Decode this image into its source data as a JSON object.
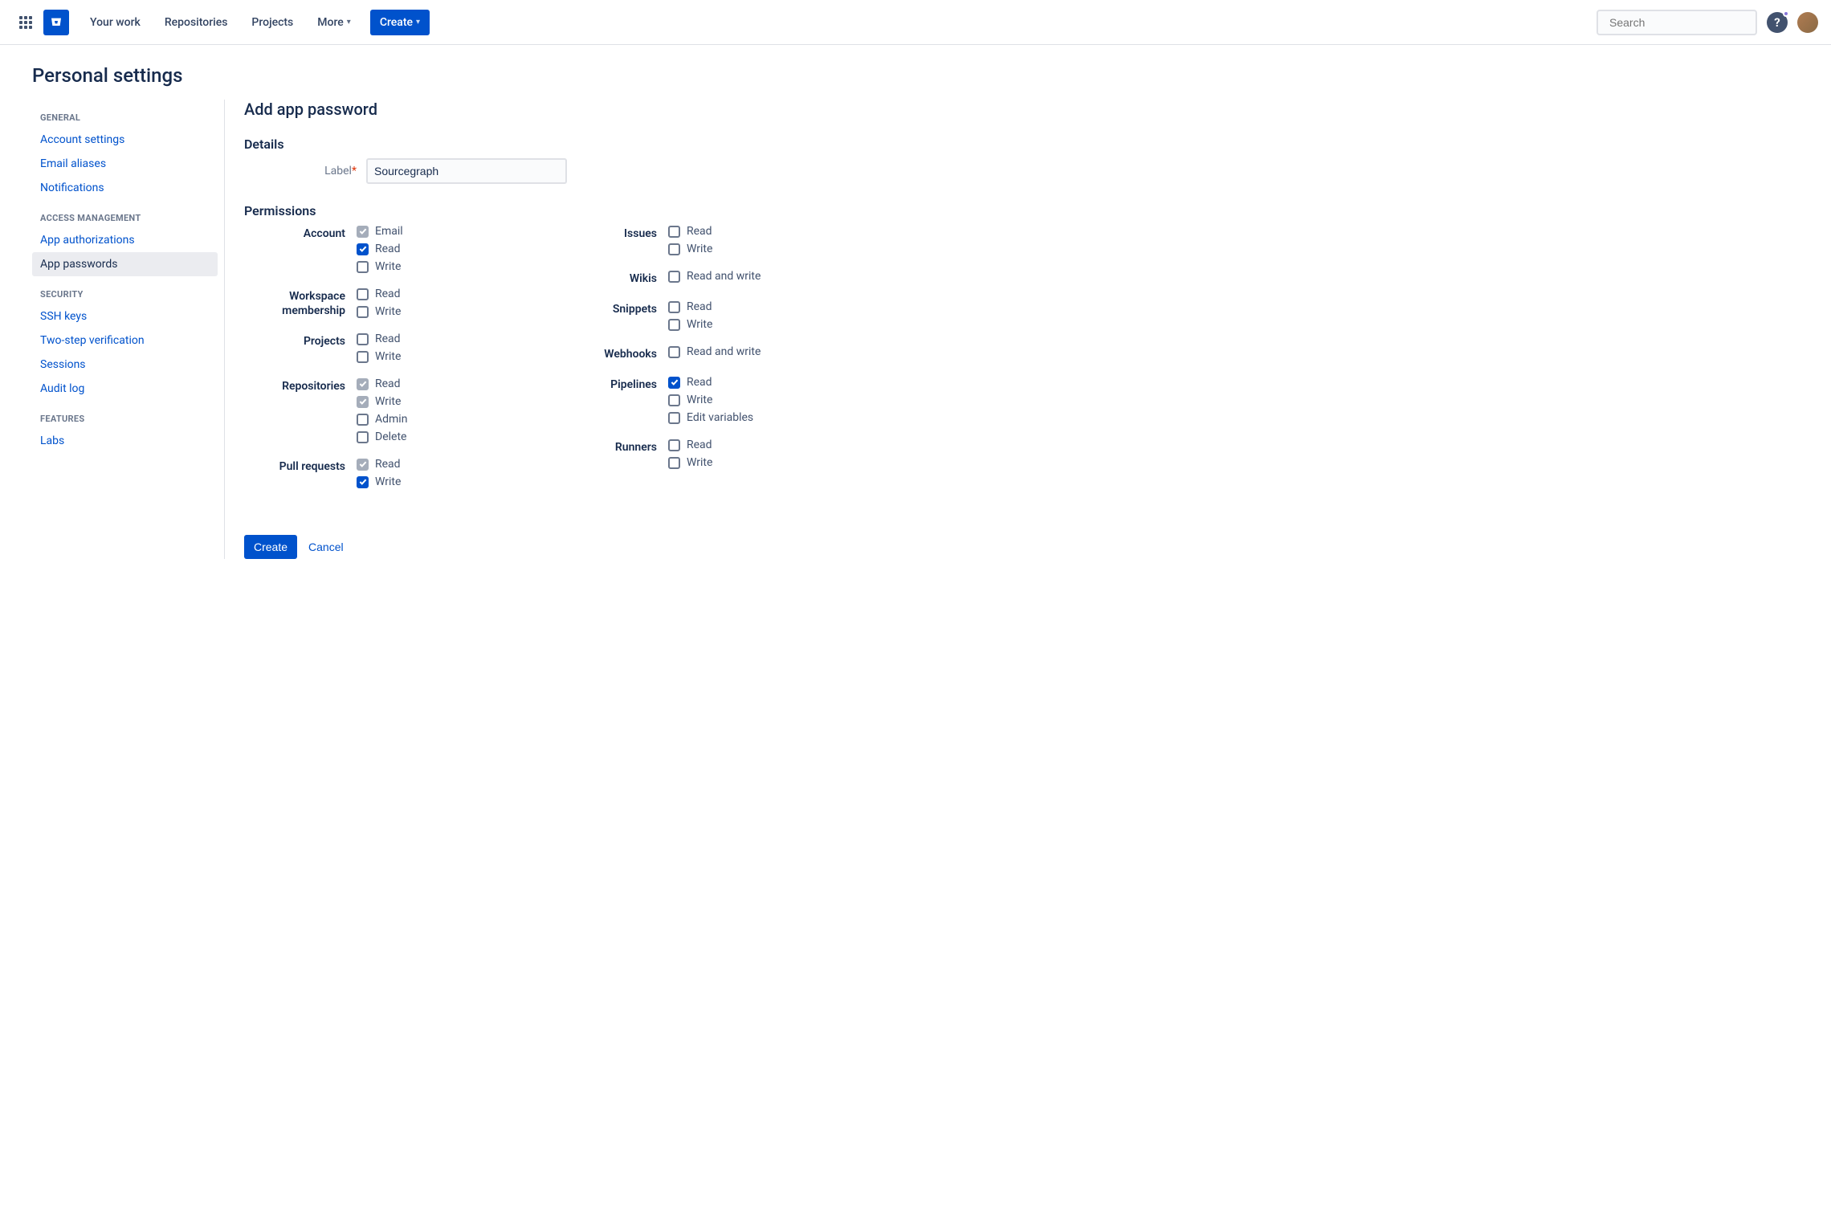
{
  "topnav": {
    "items": [
      {
        "label": "Your work"
      },
      {
        "label": "Repositories"
      },
      {
        "label": "Projects"
      },
      {
        "label": "More"
      }
    ],
    "create_label": "Create",
    "search_placeholder": "Search"
  },
  "page_title": "Personal settings",
  "sidebar": {
    "sections": [
      {
        "label": "GENERAL",
        "items": [
          {
            "label": "Account settings"
          },
          {
            "label": "Email aliases"
          },
          {
            "label": "Notifications"
          }
        ]
      },
      {
        "label": "ACCESS MANAGEMENT",
        "items": [
          {
            "label": "App authorizations"
          },
          {
            "label": "App passwords",
            "active": true
          }
        ]
      },
      {
        "label": "SECURITY",
        "items": [
          {
            "label": "SSH keys"
          },
          {
            "label": "Two-step verification"
          },
          {
            "label": "Sessions"
          },
          {
            "label": "Audit log"
          }
        ]
      },
      {
        "label": "FEATURES",
        "items": [
          {
            "label": "Labs"
          }
        ]
      }
    ]
  },
  "main": {
    "heading": "Add app password",
    "details_heading": "Details",
    "label_field": {
      "label": "Label",
      "value": "Sourcegraph"
    },
    "permissions_heading": "Permissions",
    "left_groups": [
      {
        "name": "Account",
        "opts": [
          {
            "label": "Email",
            "state": "disabled"
          },
          {
            "label": "Read",
            "state": "checked"
          },
          {
            "label": "Write",
            "state": ""
          }
        ]
      },
      {
        "name": "Workspace membership",
        "opts": [
          {
            "label": "Read",
            "state": ""
          },
          {
            "label": "Write",
            "state": ""
          }
        ]
      },
      {
        "name": "Projects",
        "opts": [
          {
            "label": "Read",
            "state": ""
          },
          {
            "label": "Write",
            "state": ""
          }
        ]
      },
      {
        "name": "Repositories",
        "opts": [
          {
            "label": "Read",
            "state": "disabled"
          },
          {
            "label": "Write",
            "state": "disabled"
          },
          {
            "label": "Admin",
            "state": ""
          },
          {
            "label": "Delete",
            "state": ""
          }
        ]
      },
      {
        "name": "Pull requests",
        "opts": [
          {
            "label": "Read",
            "state": "disabled"
          },
          {
            "label": "Write",
            "state": "checked"
          }
        ]
      }
    ],
    "right_groups": [
      {
        "name": "Issues",
        "opts": [
          {
            "label": "Read",
            "state": ""
          },
          {
            "label": "Write",
            "state": ""
          }
        ]
      },
      {
        "name": "Wikis",
        "opts": [
          {
            "label": "Read and write",
            "state": ""
          }
        ]
      },
      {
        "name": "Snippets",
        "opts": [
          {
            "label": "Read",
            "state": ""
          },
          {
            "label": "Write",
            "state": ""
          }
        ]
      },
      {
        "name": "Webhooks",
        "opts": [
          {
            "label": "Read and write",
            "state": ""
          }
        ]
      },
      {
        "name": "Pipelines",
        "opts": [
          {
            "label": "Read",
            "state": "checked"
          },
          {
            "label": "Write",
            "state": ""
          },
          {
            "label": "Edit variables",
            "state": ""
          }
        ]
      },
      {
        "name": "Runners",
        "opts": [
          {
            "label": "Read",
            "state": ""
          },
          {
            "label": "Write",
            "state": ""
          }
        ]
      }
    ],
    "actions": {
      "create": "Create",
      "cancel": "Cancel"
    }
  }
}
